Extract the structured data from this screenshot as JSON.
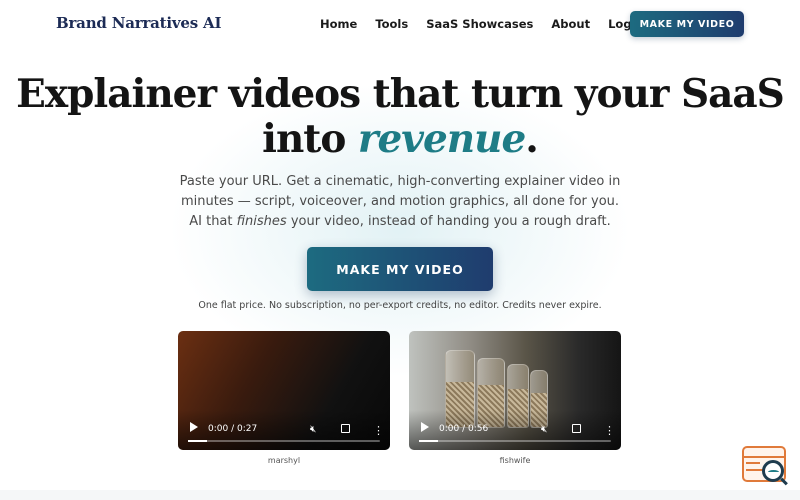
{
  "header": {
    "brand": "Brand Narratives AI",
    "nav": [
      "Home",
      "Tools",
      "SaaS Showcases",
      "About",
      "Log in"
    ],
    "cta_label": "MAKE MY VIDEO"
  },
  "hero": {
    "headline_line1": "Explainer videos that turn your SaaS",
    "headline_line2_prefix": "into ",
    "headline_accent": "revenue",
    "headline_period": ".",
    "subtitle_part1": "Paste your URL. Get a cinematic, high-converting explainer video in minutes — script, voiceover, and motion graphics, all done for you. AI that ",
    "subtitle_emphasis": "finishes",
    "subtitle_part2": " your video, instead of handing you a rough draft.",
    "cta_label": "MAKE MY VIDEO",
    "fine_print": "One flat price. No subscription, no per-export credits, no editor. Credits never expire."
  },
  "videos": [
    {
      "time": "0:00 / 0:27",
      "caption": "marshyl",
      "progress": 0.1
    },
    {
      "time": "0:00 / 0:56",
      "caption": "fishwife",
      "progress": 0.1
    }
  ],
  "icons": {
    "play": "play-icon",
    "mute": "muted-speaker-icon",
    "fullscreen": "fullscreen-icon",
    "more": "more-vertical-icon",
    "widget": "search-chat-icon"
  },
  "colors": {
    "brand": "#1c2b55",
    "accent": "#1e7c86",
    "button_gradient_start": "#1d6b80",
    "button_gradient_end": "#1f3c6e",
    "widget_orange": "#e07a3a"
  }
}
